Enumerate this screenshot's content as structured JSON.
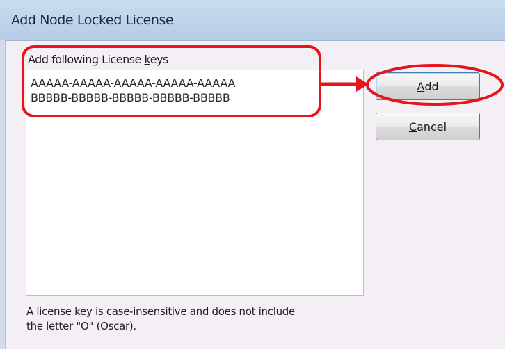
{
  "window": {
    "title": "Add Node Locked License"
  },
  "keys": {
    "label_prefix": "Add following License ",
    "label_accel": "k",
    "label_suffix": "eys",
    "lines": [
      "AAAAA-AAAAA-AAAAA-AAAAA-AAAAA",
      "BBBBB-BBBBB-BBBBB-BBBBB-BBBBB"
    ]
  },
  "buttons": {
    "add": {
      "accel": "A",
      "rest": "dd"
    },
    "cancel": {
      "accel": "C",
      "rest": "ancel"
    }
  },
  "note": {
    "line1": "A license key is case-insensitive and does not include",
    "line2": "the letter \"O\" (Oscar)."
  },
  "annotation": {
    "color": "#e8141b"
  }
}
